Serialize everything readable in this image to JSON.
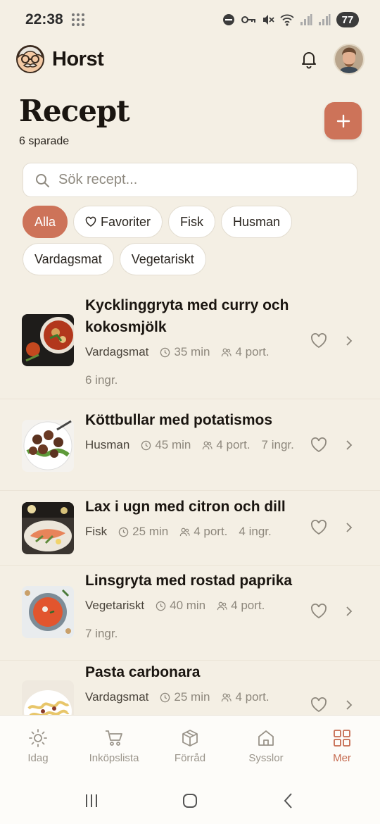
{
  "status_bar": {
    "time": "22:38",
    "battery": "77"
  },
  "app": {
    "name": "Horst"
  },
  "page": {
    "title": "Recept",
    "saved_count": "6 sparade",
    "add_label": "+"
  },
  "search": {
    "placeholder": "Sök recept..."
  },
  "filters": [
    {
      "label": "Alla",
      "active": true
    },
    {
      "label": "Favoriter",
      "icon": "heart-icon"
    },
    {
      "label": "Fisk"
    },
    {
      "label": "Husman"
    },
    {
      "label": "Vardagsmat"
    },
    {
      "label": "Vegetariskt"
    }
  ],
  "recipes": [
    {
      "title": "Kycklinggryta med curry och kokosmjölk",
      "category": "Vardagsmat",
      "time": "35 min",
      "portions": "4 port.",
      "ingredients": "6 ingr."
    },
    {
      "title": "Köttbullar med potatismos",
      "category": "Husman",
      "time": "45 min",
      "portions": "4 port.",
      "ingredients": "7 ingr."
    },
    {
      "title": "Lax i ugn med citron och dill",
      "category": "Fisk",
      "time": "25 min",
      "portions": "4 port.",
      "ingredients": "4 ingr."
    },
    {
      "title": "Linsgryta med rostad paprika",
      "category": "Vegetariskt",
      "time": "40 min",
      "portions": "4 port.",
      "ingredients": "7 ingr."
    },
    {
      "title": "Pasta carbonara",
      "category": "Vardagsmat",
      "time": "25 min",
      "portions": "4 port.",
      "ingredients": ""
    }
  ],
  "bottom_nav": [
    {
      "label": "Idag",
      "icon": "sun-icon"
    },
    {
      "label": "Inköpslista",
      "icon": "cart-icon"
    },
    {
      "label": "Förråd",
      "icon": "box-icon"
    },
    {
      "label": "Sysslor",
      "icon": "home-icon"
    },
    {
      "label": "Mer",
      "icon": "grid-icon",
      "active": true
    }
  ],
  "colors": {
    "accent": "#cd7359",
    "background": "#f4efe4",
    "nav_active": "#c56a4f"
  }
}
